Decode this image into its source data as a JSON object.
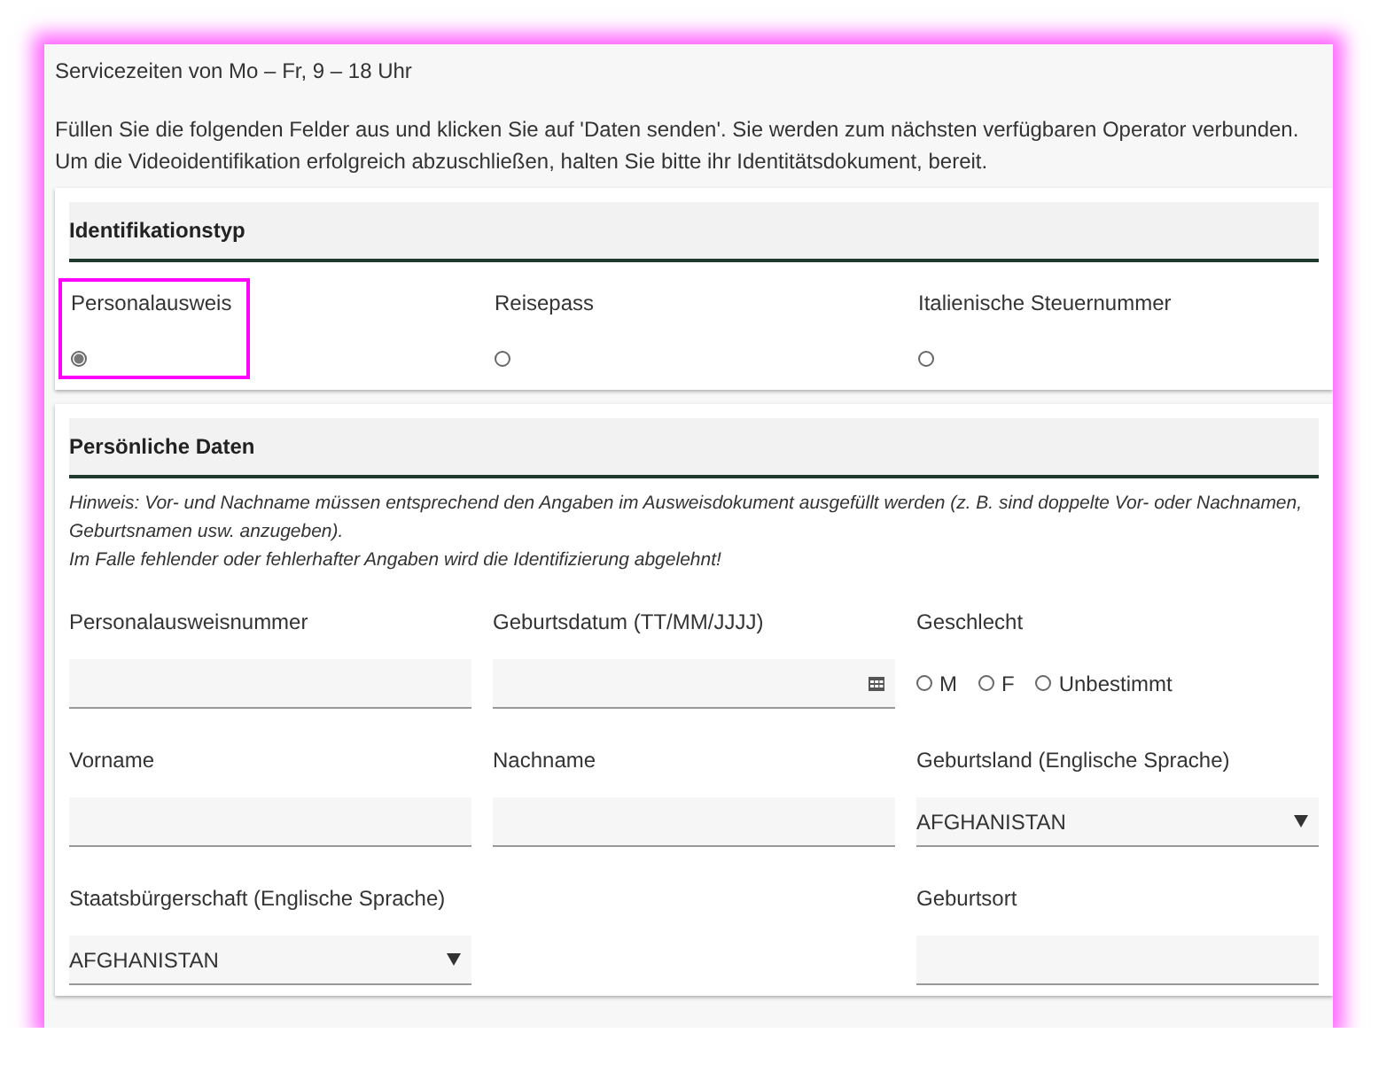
{
  "service_hours": "Servicezeiten von Mo – Fr, 9 – 18 Uhr",
  "intro": "Füllen Sie die folgenden Felder aus und klicken Sie auf 'Daten senden'. Sie werden zum nächsten verfügbaren Operator verbunden. Um die Videoidentifikation erfolgreich abzuschließen, halten Sie bitte ihr Identitätsdokument, bereit.",
  "identification": {
    "title": "Identifikationstyp",
    "options": [
      {
        "label": "Personalausweis",
        "selected": true,
        "highlighted": true
      },
      {
        "label": "Reisepass",
        "selected": false,
        "highlighted": false
      },
      {
        "label": "Italienische Steuernummer",
        "selected": false,
        "highlighted": false
      }
    ]
  },
  "personal": {
    "title": "Persönliche Daten",
    "notes": [
      "Hinweis: Vor- und Nachname müssen entsprechend den Angaben im Ausweisdokument ausgefüllt werden (z. B. sind doppelte Vor- oder Nachnamen, Geburtsnamen usw. anzugeben).",
      "Im Falle fehlender oder fehlerhafter Angaben wird die Identifizierung abgelehnt!"
    ],
    "rows": [
      [
        {
          "kind": "text",
          "label": "Personalausweisnummer"
        },
        {
          "kind": "date",
          "label": "Geburtsdatum (TT/MM/JJJJ)"
        },
        {
          "kind": "radio",
          "label": "Geschlecht",
          "options": [
            {
              "label": "M",
              "selected": false
            },
            {
              "label": "F",
              "selected": false
            },
            {
              "label": "Unbestimmt",
              "selected": false
            }
          ]
        }
      ],
      [
        {
          "kind": "text",
          "label": "Vorname"
        },
        {
          "kind": "text",
          "label": "Nachname"
        },
        {
          "kind": "select",
          "label": "Geburtsland (Englische Sprache)",
          "value": "AFGHANISTAN"
        }
      ],
      [
        {
          "kind": "select",
          "label": "Staatsbürgerschaft (Englische Sprache)",
          "value": "AFGHANISTAN"
        },
        null,
        {
          "kind": "text",
          "label": "Geburtsort"
        }
      ]
    ]
  }
}
